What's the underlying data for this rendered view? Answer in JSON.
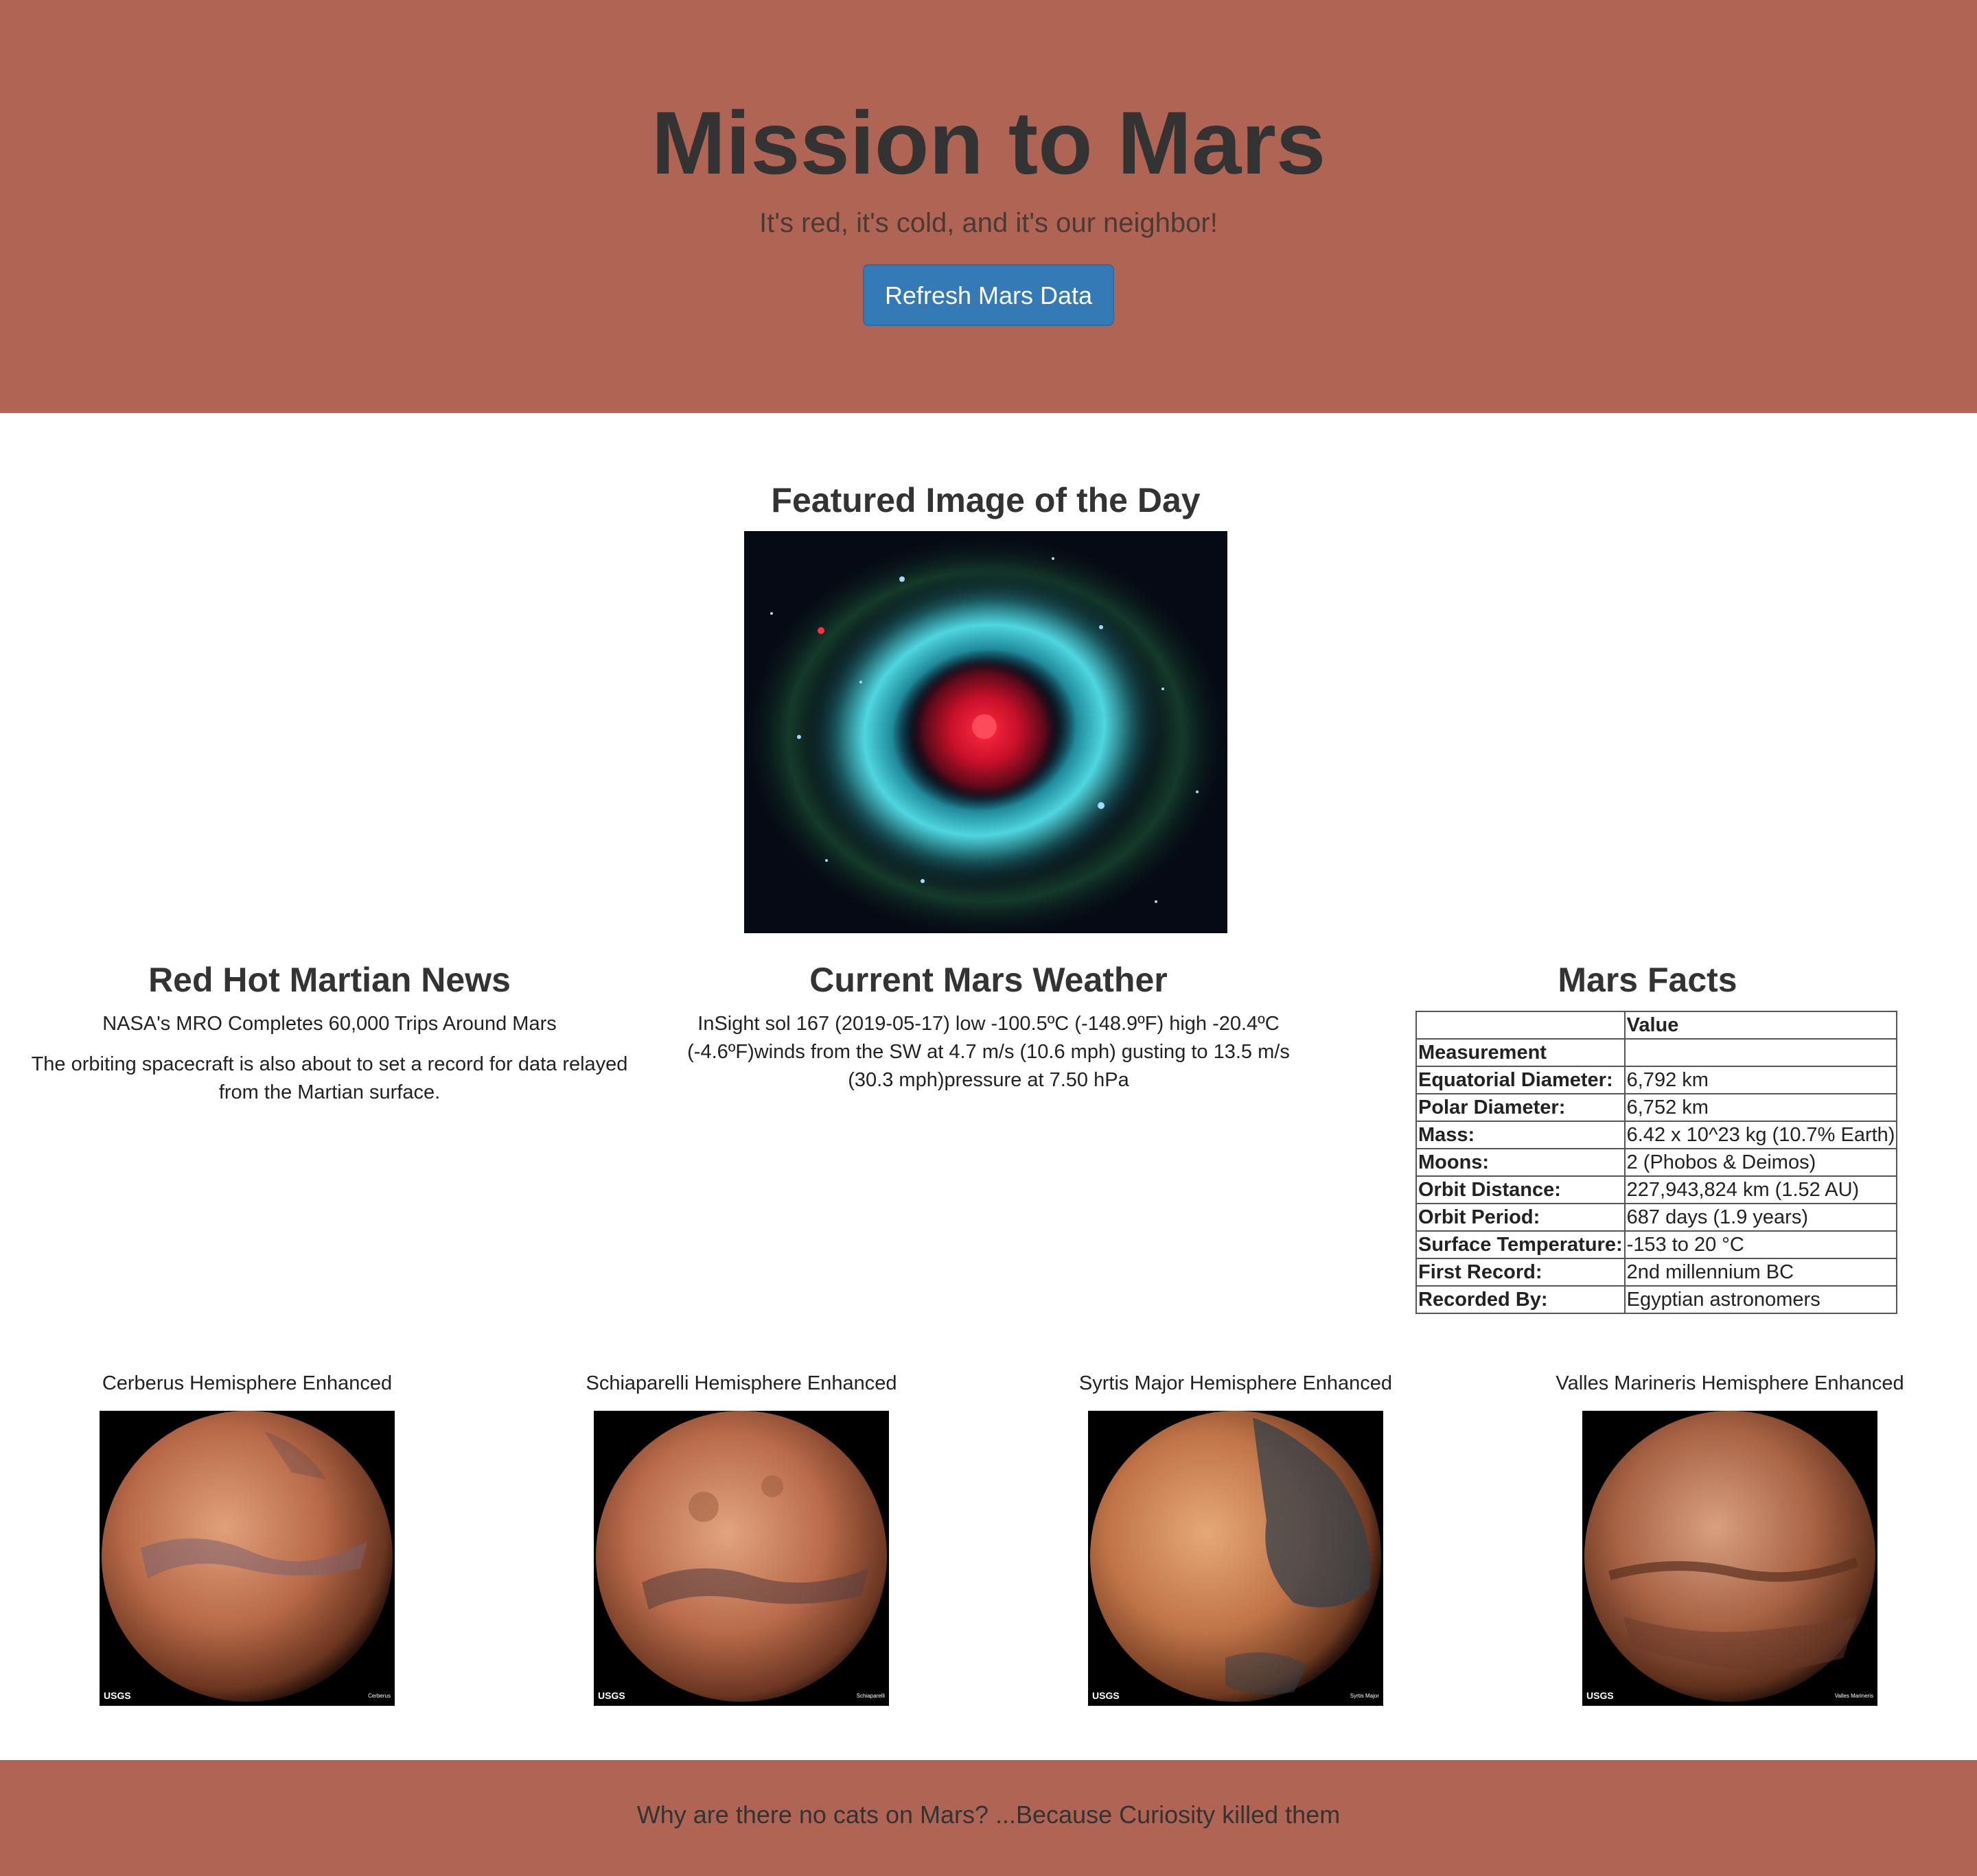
{
  "header": {
    "title": "Mission to Mars",
    "subtitle": "It's red, it's cold, and it's our neighbor!",
    "refresh_button": "Refresh Mars Data",
    "background_color": "#b06454",
    "button_color": "#337ab7"
  },
  "featured": {
    "heading": "Featured Image of the Day",
    "image_icon": "helix-nebula-image"
  },
  "news": {
    "heading": "Red Hot Martian News",
    "title": "NASA's MRO Completes 60,000 Trips Around Mars",
    "paragraph": "The orbiting spacecraft is also about to set a record for data relayed from the Martian surface."
  },
  "weather": {
    "heading": "Current Mars Weather",
    "text": "InSight sol 167 (2019-05-17) low -100.5ºC (-148.9ºF) high -20.4ºC (-4.6ºF)winds from the SW at 4.7 m/s (10.6 mph) gusting to 13.5 m/s (30.3 mph)pressure at 7.50 hPa"
  },
  "facts": {
    "heading": "Mars Facts",
    "header_row": [
      "",
      "Value"
    ],
    "index_label": "Measurement",
    "rows": [
      {
        "key": "Equatorial Diameter:",
        "value": "6,792 km"
      },
      {
        "key": "Polar Diameter:",
        "value": "6,752 km"
      },
      {
        "key": "Mass:",
        "value": "6.42 x 10^23 kg (10.7% Earth)"
      },
      {
        "key": "Moons:",
        "value": "2 (Phobos & Deimos)"
      },
      {
        "key": "Orbit Distance:",
        "value": "227,943,824 km (1.52 AU)"
      },
      {
        "key": "Orbit Period:",
        "value": "687 days (1.9 years)"
      },
      {
        "key": "Surface Temperature:",
        "value": "-153 to 20 °C"
      },
      {
        "key": "First Record:",
        "value": "2nd millennium BC"
      },
      {
        "key": "Recorded By:",
        "value": "Egyptian astronomers"
      }
    ]
  },
  "hemispheres": [
    {
      "title": "Cerberus Hemisphere Enhanced",
      "caption": "Cerberus"
    },
    {
      "title": "Schiaparelli Hemisphere Enhanced",
      "caption": "Schiaparelli"
    },
    {
      "title": "Syrtis Major Hemisphere Enhanced",
      "caption": "Syrtis Major"
    },
    {
      "title": "Valles Marineris Hemisphere Enhanced",
      "caption": "Valles Marineris"
    }
  ],
  "hemisphere_logo": "USGS",
  "footer": {
    "text": "Why are there no cats on Mars? ...Because Curiosity killed them"
  }
}
